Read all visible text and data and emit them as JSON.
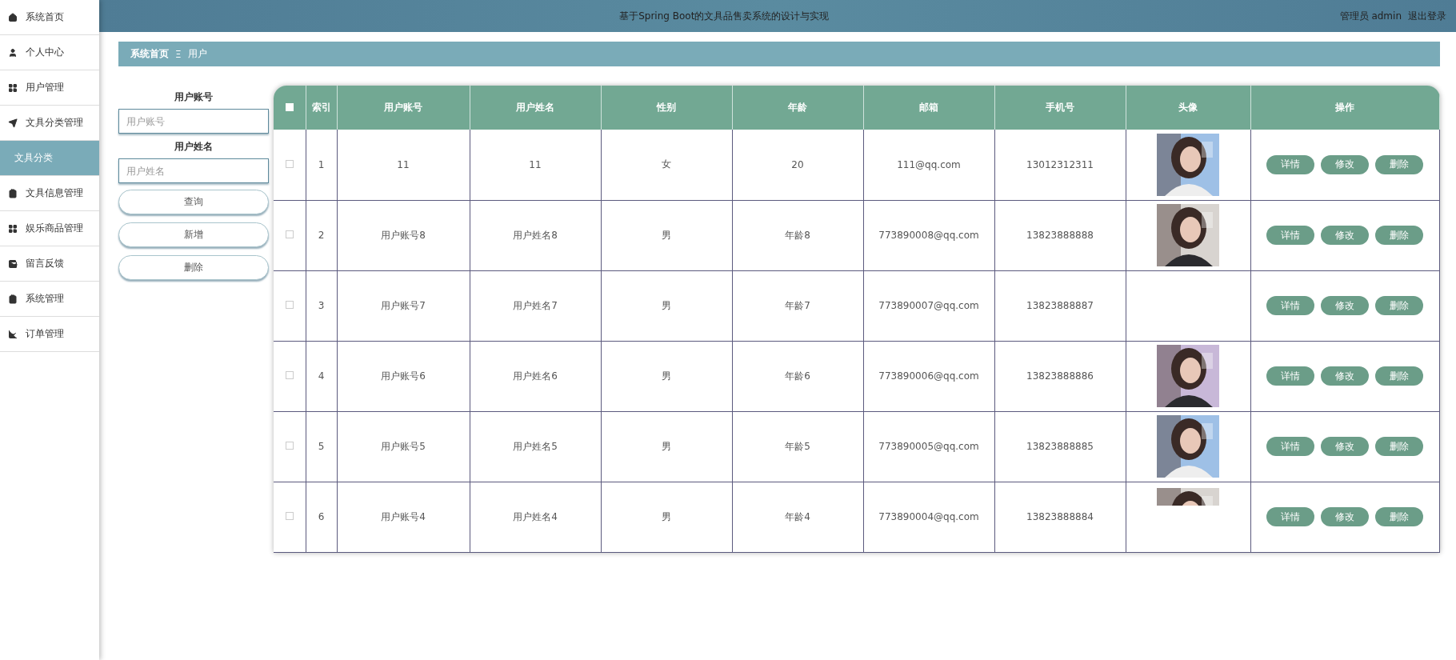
{
  "header": {
    "title": "基于Spring Boot的文具品售卖系统的设计与实现",
    "user": "管理员 admin",
    "logout": "退出登录"
  },
  "sidebar": {
    "items": [
      {
        "label": "系统首页",
        "selected": false
      },
      {
        "label": "个人中心",
        "selected": false
      },
      {
        "label": "用户管理",
        "selected": false
      },
      {
        "label": "文具分类管理",
        "selected": false,
        "expanded": true,
        "children": [
          {
            "label": "文具分类",
            "selected": true
          }
        ]
      },
      {
        "label": "文具信息管理",
        "selected": false
      },
      {
        "label": "娱乐商品管理",
        "selected": false
      },
      {
        "label": "留言反馈",
        "selected": false
      },
      {
        "label": "系统管理",
        "selected": false
      },
      {
        "label": "订单管理",
        "selected": false
      }
    ]
  },
  "breadcrumb": {
    "home": "系统首页",
    "separator": "Ξ",
    "current": "用户"
  },
  "filters": {
    "fields": [
      {
        "label": "用户账号",
        "placeholder": "用户账号"
      },
      {
        "label": "用户姓名",
        "placeholder": "用户姓名"
      }
    ],
    "buttons": [
      "查询",
      "新增",
      "删除"
    ]
  },
  "table": {
    "select_all": {
      "checked": false
    },
    "columns": [
      "索引",
      "用户账号",
      "用户姓名",
      "性别",
      "年龄",
      "邮箱",
      "手机号",
      "头像",
      "操作"
    ],
    "rows": [
      {
        "checked": false,
        "cells": [
          "1",
          "11",
          "11",
          "女",
          "20",
          "111@qq.com",
          "13012312311"
        ],
        "actions": [
          "详情",
          "修改",
          "删除"
        ]
      },
      {
        "checked": false,
        "cells": [
          "2",
          "用户账号8",
          "用户姓名8",
          "男",
          "年龄8",
          "773890008@qq.com",
          "13823888888"
        ],
        "actions": [
          "详情",
          "修改",
          "删除"
        ]
      },
      {
        "checked": false,
        "cells": [
          "3",
          "用户账号7",
          "用户姓名7",
          "男",
          "年龄7",
          "773890007@qq.com",
          "13823888887"
        ],
        "actions": [
          "详情",
          "修改",
          "删除"
        ]
      },
      {
        "checked": false,
        "cells": [
          "4",
          "用户账号6",
          "用户姓名6",
          "男",
          "年龄6",
          "773890006@qq.com",
          "13823888886"
        ],
        "actions": [
          "详情",
          "修改",
          "删除"
        ]
      },
      {
        "checked": false,
        "cells": [
          "5",
          "用户账号5",
          "用户姓名5",
          "男",
          "年龄5",
          "773890005@qq.com",
          "13823888885"
        ],
        "actions": [
          "详情",
          "修改",
          "删除"
        ]
      },
      {
        "checked": false,
        "cells": [
          "6",
          "用户账号4",
          "用户姓名4",
          "男",
          "年龄4",
          "773890004@qq.com",
          "13823888884"
        ],
        "avatar": {
          "kind": "strip"
        },
        "actions": [
          "详情",
          "修改",
          "删除"
        ]
      }
    ]
  }
}
